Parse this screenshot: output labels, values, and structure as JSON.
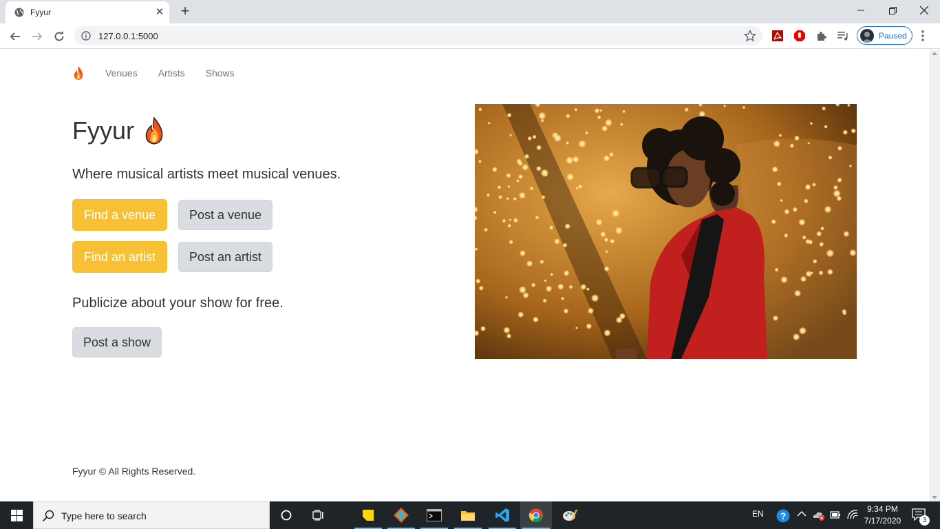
{
  "browser": {
    "tab_title": "Fyyur",
    "url": "127.0.0.1:5000",
    "profile_label": "Paused"
  },
  "site": {
    "nav": {
      "brand_icon": "fire-emoji",
      "links": [
        "Venues",
        "Artists",
        "Shows"
      ]
    },
    "hero": {
      "title": "Fyyur",
      "tagline": "Where musical artists meet musical venues.",
      "buttons": {
        "find_venue": "Find a venue",
        "post_venue": "Post a venue",
        "find_artist": "Find an artist",
        "post_artist": "Post an artist"
      },
      "publicize_text": "Publicize about your show for free.",
      "post_show": "Post a show"
    },
    "footer": "Fyyur © All Rights Reserved.",
    "colors": {
      "primary": "#f7c035",
      "secondary": "#d9dde2"
    }
  },
  "taskbar": {
    "search_placeholder": "Type here to search",
    "language": "EN",
    "time": "9:34 PM",
    "date": "7/17/2020",
    "notification_count": "3"
  }
}
